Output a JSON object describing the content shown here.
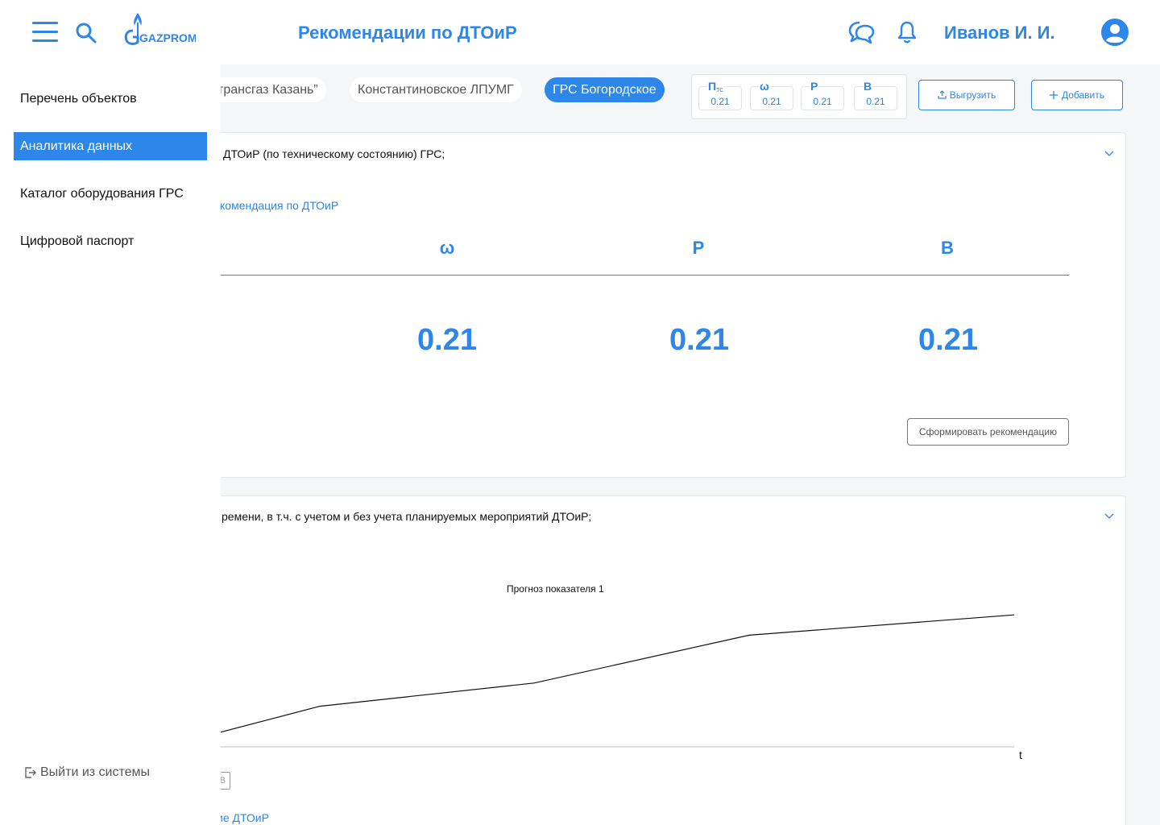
{
  "header": {
    "logo_text": "GAZPROM",
    "title": "Рекомендации по ДТОиР",
    "user_name": "Иванов И. И."
  },
  "sidebar": {
    "items": [
      {
        "label": "Перечень объектов",
        "active": false
      },
      {
        "label": "Аналитика данных",
        "active": true
      },
      {
        "label": "Каталог оборудования ГРС",
        "active": false
      },
      {
        "label": "Цифровой паспорт",
        "active": false
      }
    ],
    "logout_label": "Выйти из системы"
  },
  "filters": {
    "chips": [
      {
        "label": "трансгаз Казань”",
        "active": false
      },
      {
        "label": "Константиновское ЛПУМГ",
        "active": false
      },
      {
        "label": "ГРС Богородское",
        "active": true
      }
    ]
  },
  "metrics": [
    {
      "name": "П",
      "sub": "тс",
      "value": "0.21"
    },
    {
      "name": "ω",
      "sub": "",
      "value": "0.21"
    },
    {
      "name": "Р",
      "sub": "",
      "value": "0.21"
    },
    {
      "name": "В",
      "sub": "",
      "value": "0.21"
    }
  ],
  "toolbar": {
    "export_label": "Выгрузить",
    "add_label": "Добавить"
  },
  "card1": {
    "title": "ДТОиР (по техническому состоянию)  ГРС;",
    "link": "комендация по ДТОиР",
    "columns": [
      {
        "name": "ω",
        "value": "0.21"
      },
      {
        "name": "Р",
        "value": "0.21"
      },
      {
        "name": "В",
        "value": "0.21"
      }
    ],
    "button_label": "Сформировать рекомендацию"
  },
  "card2": {
    "title": "ремени, в т.ч. с учетом и без учета планируемых мероприятий ДТОиР;",
    "tick_box_label": "В",
    "link": "ие ДТОиР"
  },
  "chart_data": {
    "type": "line",
    "title": "Прогноз показателя 1",
    "xlabel": "t",
    "ylabel": "",
    "series": [
      {
        "values": [
          0.1,
          0.28,
          0.44,
          0.77,
          0.91
        ]
      }
    ],
    "grid": false,
    "colors": {
      "line": "#111111"
    }
  },
  "colors": {
    "accent": "#2d86e8",
    "content_bg": "#f4f6f8"
  }
}
